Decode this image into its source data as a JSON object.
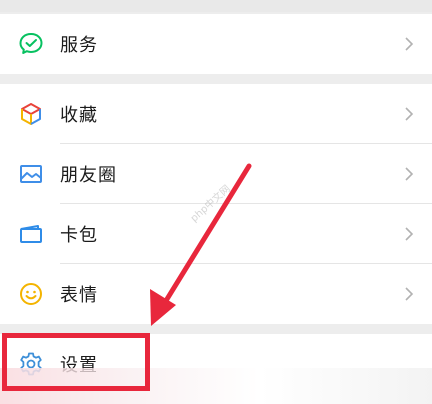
{
  "menu": {
    "items": [
      {
        "label": "服务",
        "icon": "wechat-pay-icon"
      },
      {
        "label": "收藏",
        "icon": "cube-icon"
      },
      {
        "label": "朋友圈",
        "icon": "image-icon"
      },
      {
        "label": "卡包",
        "icon": "wallet-card-icon"
      },
      {
        "label": "表情",
        "icon": "smiley-icon"
      },
      {
        "label": "设置",
        "icon": "gear-icon"
      }
    ]
  },
  "annotation": {
    "highlight_color": "#e8273c",
    "arrow_color": "#e8273c",
    "watermark": "php中文网"
  },
  "colors": {
    "service_icon": "#07c160",
    "album_icon": "#3f8ee8",
    "card_icon": "#2f8ce8",
    "emoji_icon": "#f4b400",
    "settings_icon": "#3d8fd8"
  }
}
